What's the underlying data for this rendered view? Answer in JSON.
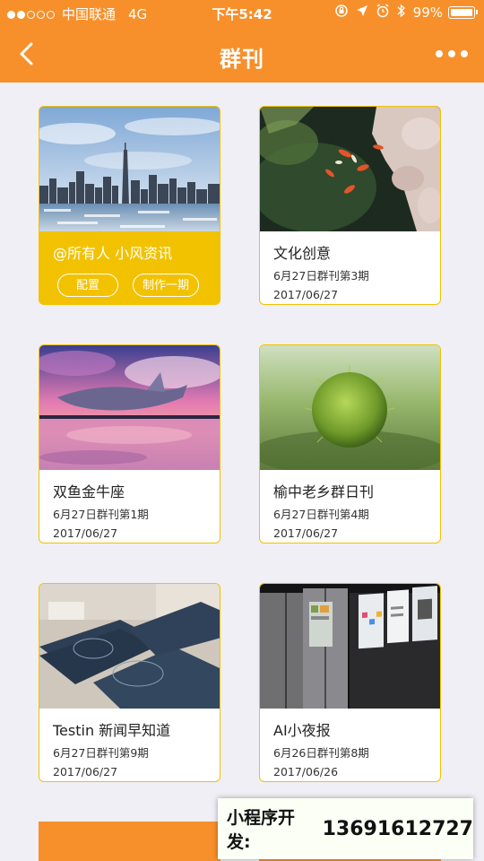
{
  "status_bar": {
    "carrier": "中国联通",
    "network": "4G",
    "time": "下午5:42",
    "battery": "99%"
  },
  "nav": {
    "title": "群刊",
    "back_icon": "chevron-left-icon",
    "more_icon": "more-dots-icon"
  },
  "featured": {
    "title": "@所有人 小风资讯",
    "buttons": [
      "配置",
      "制作一期"
    ]
  },
  "cards": [
    {
      "title": "文化创意",
      "issue": "6月27日群刊第3期",
      "date": "2017/06/27"
    },
    {
      "title": "双鱼金牛座",
      "issue": "6月27日群刊第1期",
      "date": "2017/06/27"
    },
    {
      "title": "榆中老乡群日刊",
      "issue": "6月27日群刊第4期",
      "date": "2017/06/27"
    },
    {
      "title": "Testin 新闻早知道",
      "issue": "6月27日群刊第9期",
      "date": "2017/06/27"
    },
    {
      "title": "AI小夜报",
      "issue": "6月26日群刊第8期",
      "date": "2017/06/26"
    }
  ],
  "banner": {
    "label": "小程序开发:",
    "phone": "13691612727"
  },
  "colors": {
    "accent": "#f7902a",
    "card_border": "#f2c200",
    "background": "#f0eff5"
  }
}
